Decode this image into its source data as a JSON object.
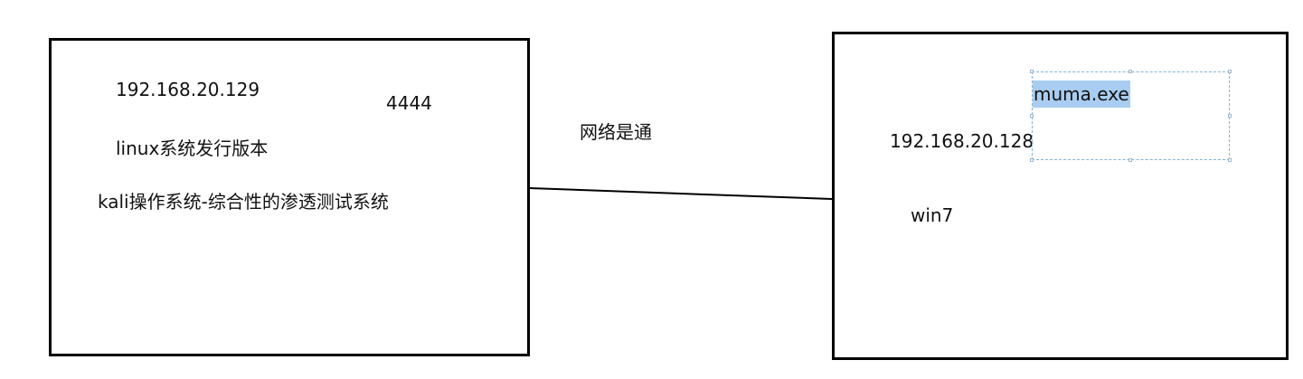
{
  "attacker": {
    "ip": "192.168.20.129",
    "port": "4444",
    "distro": "linux系统发行版本",
    "description": "kali操作系统-综合性的渗透测试系统"
  },
  "link": {
    "label": "网络是通"
  },
  "victim": {
    "ip": "192.168.20.128",
    "os": "win7",
    "payload": "muma.exe"
  },
  "colors": {
    "border": "#000000",
    "selection_highlight": "#a8cdf0",
    "selection_frame": "#7fb3d9"
  }
}
